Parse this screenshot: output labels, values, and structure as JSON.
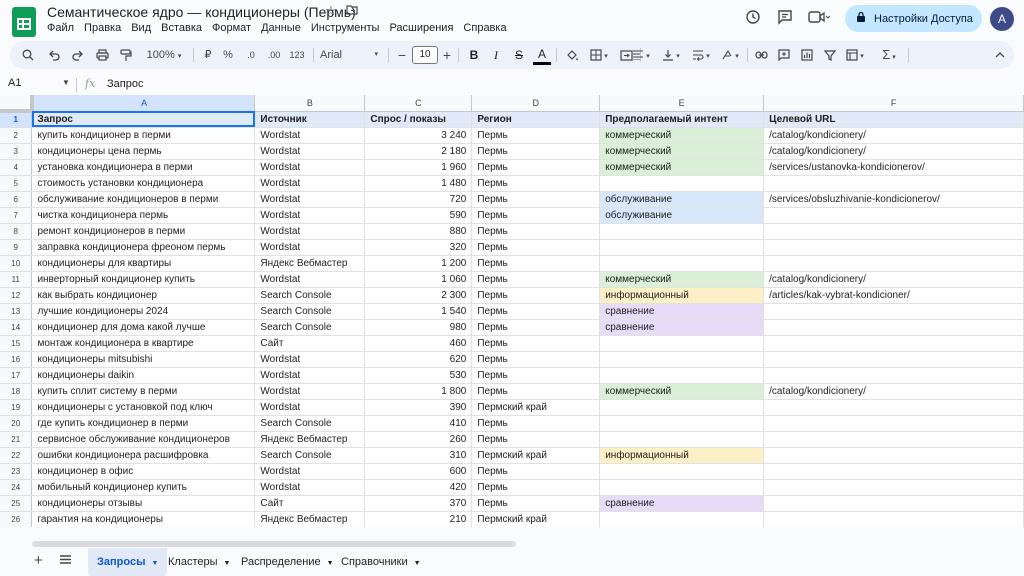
{
  "doc": {
    "title": "Семантическое ядро — кондиционеры (Пермь)",
    "menu": [
      "Файл",
      "Правка",
      "Вид",
      "Вставка",
      "Формат",
      "Данные",
      "Инструменты",
      "Расширения",
      "Справка"
    ],
    "share_label": "Настройки Доступа",
    "avatar_letter": "A"
  },
  "toolbar": {
    "zoom": "100%",
    "currency": "₽",
    "percent": "%",
    "decimals_dec": ".0",
    "decimals_inc": ".00",
    "format_123": "123",
    "font": "Arial",
    "font_size": "10",
    "bold": "B",
    "italic": "I",
    "underline_a": "A",
    "sigma": "Σ"
  },
  "formula_bar": {
    "cell_ref": "A1",
    "fx": "fx",
    "content": "Запрос"
  },
  "columns": [
    "A",
    "B",
    "C",
    "D",
    "E",
    "F"
  ],
  "header_row": [
    "Запрос",
    "Источник",
    "Спрос / показы",
    "Регион",
    "Предполагаемый интент",
    "Целевой URL"
  ],
  "rows": [
    {
      "q": "купить кондиционер в перми",
      "src": "Wordstat",
      "demand": "3 240",
      "region": "Пермь",
      "intent": "коммерческий",
      "intent_type": "commercial",
      "url": "/catalog/kondicionery/"
    },
    {
      "q": "кондиционеры цена пермь",
      "src": "Wordstat",
      "demand": "2 180",
      "region": "Пермь",
      "intent": "коммерческий",
      "intent_type": "commercial",
      "url": "/catalog/kondicionery/"
    },
    {
      "q": "установка кондиционера в перми",
      "src": "Wordstat",
      "demand": "1 960",
      "region": "Пермь",
      "intent": "коммерческий",
      "intent_type": "commercial",
      "url": "/services/ustanovka-kondicionerov/"
    },
    {
      "q": "стоимость установки кондиционера",
      "src": "Wordstat",
      "demand": "1 480",
      "region": "Пермь",
      "intent": "",
      "intent_type": "",
      "url": ""
    },
    {
      "q": "обслуживание кондиционеров в перми",
      "src": "Wordstat",
      "demand": "720",
      "region": "Пермь",
      "intent": "обслуживание",
      "intent_type": "service",
      "url": "/services/obsluzhivanie-kondicionerov/"
    },
    {
      "q": "чистка кондиционера пермь",
      "src": "Wordstat",
      "demand": "590",
      "region": "Пермь",
      "intent": "обслуживание",
      "intent_type": "service",
      "url": ""
    },
    {
      "q": "ремонт кондиционеров в перми",
      "src": "Wordstat",
      "demand": "880",
      "region": "Пермь",
      "intent": "",
      "intent_type": "",
      "url": ""
    },
    {
      "q": "заправка кондиционера фреоном пермь",
      "src": "Wordstat",
      "demand": "320",
      "region": "Пермь",
      "intent": "",
      "intent_type": "",
      "url": ""
    },
    {
      "q": "кондиционеры для квартиры",
      "src": "Яндекс Вебмастер",
      "demand": "1 200",
      "region": "Пермь",
      "intent": "",
      "intent_type": "",
      "url": ""
    },
    {
      "q": "инверторный кондиционер купить",
      "src": "Wordstat",
      "demand": "1 060",
      "region": "Пермь",
      "intent": "коммерческий",
      "intent_type": "commercial",
      "url": "/catalog/kondicionery/"
    },
    {
      "q": "как выбрать кондиционер",
      "src": "Search Console",
      "demand": "2 300",
      "region": "Пермь",
      "intent": "информационный",
      "intent_type": "info",
      "url": "/articles/kak-vybrat-kondicioner/"
    },
    {
      "q": "лучшие кондиционеры 2024",
      "src": "Search Console",
      "demand": "1 540",
      "region": "Пермь",
      "intent": "сравнение",
      "intent_type": "compare",
      "url": ""
    },
    {
      "q": "кондиционер для дома какой лучше",
      "src": "Search Console",
      "demand": "980",
      "region": "Пермь",
      "intent": "сравнение",
      "intent_type": "compare",
      "url": ""
    },
    {
      "q": "монтаж кондиционера в квартире",
      "src": "Сайт",
      "demand": "460",
      "region": "Пермь",
      "intent": "",
      "intent_type": "",
      "url": ""
    },
    {
      "q": "кондиционеры mitsubishi",
      "src": "Wordstat",
      "demand": "620",
      "region": "Пермь",
      "intent": "",
      "intent_type": "",
      "url": ""
    },
    {
      "q": "кондиционеры daikin",
      "src": "Wordstat",
      "demand": "530",
      "region": "Пермь",
      "intent": "",
      "intent_type": "",
      "url": ""
    },
    {
      "q": "купить сплит систему в перми",
      "src": "Wordstat",
      "demand": "1 800",
      "region": "Пермь",
      "intent": "коммерческий",
      "intent_type": "commercial",
      "url": "/catalog/kondicionery/"
    },
    {
      "q": "кондиционеры с установкой под ключ",
      "src": "Wordstat",
      "demand": "390",
      "region": "Пермский край",
      "intent": "",
      "intent_type": "",
      "url": ""
    },
    {
      "q": "где купить кондиционер в перми",
      "src": "Search Console",
      "demand": "410",
      "region": "Пермь",
      "intent": "",
      "intent_type": "",
      "url": ""
    },
    {
      "q": "сервисное обслуживание кондиционеров",
      "src": "Яндекс Вебмастер",
      "demand": "260",
      "region": "Пермь",
      "intent": "",
      "intent_type": "",
      "url": ""
    },
    {
      "q": "ошибки кондиционера расшифровка",
      "src": "Search Console",
      "demand": "310",
      "region": "Пермский край",
      "intent": "информационный",
      "intent_type": "info",
      "url": ""
    },
    {
      "q": "кондиционер в офис",
      "src": "Wordstat",
      "demand": "600",
      "region": "Пермь",
      "intent": "",
      "intent_type": "",
      "url": ""
    },
    {
      "q": "мобильный кондиционер купить",
      "src": "Wordstat",
      "demand": "420",
      "region": "Пермь",
      "intent": "",
      "intent_type": "",
      "url": ""
    },
    {
      "q": "кондиционеры отзывы",
      "src": "Сайт",
      "demand": "370",
      "region": "Пермь",
      "intent": "сравнение",
      "intent_type": "compare",
      "url": ""
    },
    {
      "q": "гарантия на кондиционеры",
      "src": "Яндекс Вебмастер",
      "demand": "210",
      "region": "Пермский край",
      "intent": "",
      "intent_type": "",
      "url": ""
    }
  ],
  "tabs": [
    {
      "label": "Запросы",
      "active": true
    },
    {
      "label": "Кластеры",
      "active": false
    },
    {
      "label": "Распределение",
      "active": false
    },
    {
      "label": "Справочники",
      "active": false
    }
  ],
  "colors": {
    "commercial": "#dcf0d9",
    "service": "#d9e7fb",
    "info": "#fdefc6",
    "compare": "#e6dcf8",
    "accent": "#0b57d0"
  }
}
